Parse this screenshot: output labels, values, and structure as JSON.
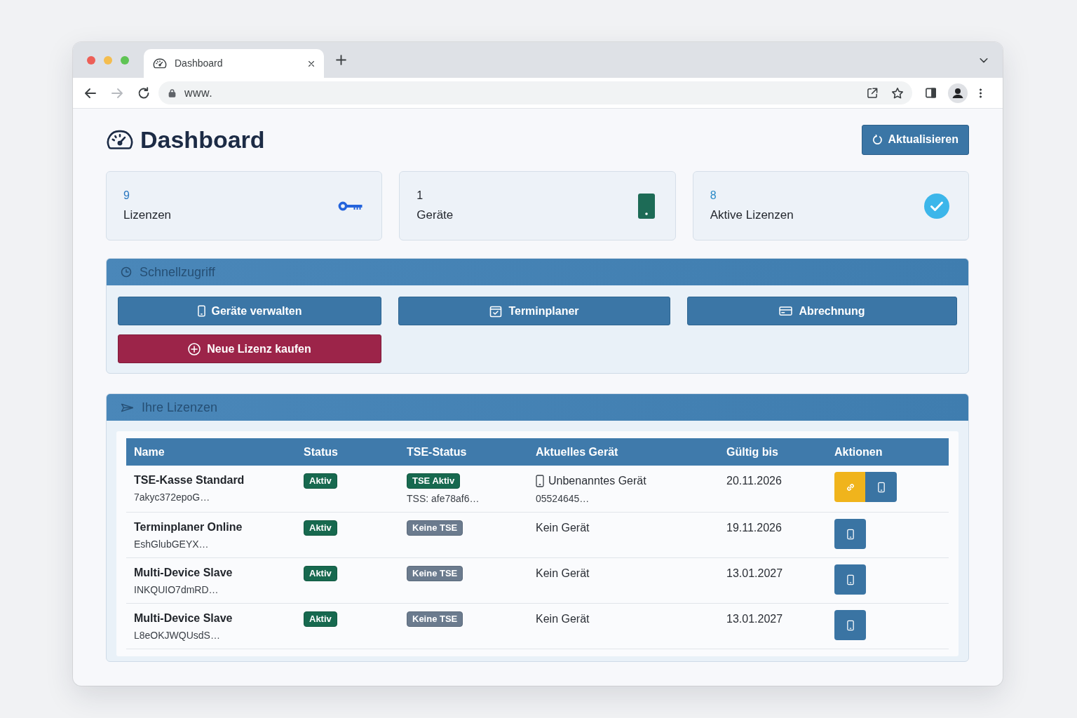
{
  "browser": {
    "tabs": [
      {
        "title": "Dashboard",
        "selected": true
      }
    ],
    "address": "www.",
    "forward_disabled": true
  },
  "header": {
    "title": "Dashboard",
    "refresh_button": "Aktualisieren"
  },
  "stats": [
    {
      "value": "9",
      "label": "Lizenzen",
      "color": "#2464dc"
    },
    {
      "value": "1",
      "label": "Geräte",
      "color": "#1d6b56"
    },
    {
      "value": "8",
      "label": "Aktive Lizenzen",
      "color": "#3cb6ea"
    }
  ],
  "quick_access": {
    "title": "Schnellzugriff",
    "buttons": [
      {
        "label": "Geräte verwalten",
        "kind": "primary"
      },
      {
        "label": "Terminplaner",
        "kind": "primary"
      },
      {
        "label": "Abrechnung",
        "kind": "primary"
      },
      {
        "label": "Neue Lizenz kaufen",
        "kind": "danger"
      }
    ]
  },
  "licenses": {
    "title": "Ihre Lizenzen",
    "table": {
      "columns": [
        "Name",
        "Status",
        "TSE-Status",
        "Aktuelles Gerät",
        "Gültig bis",
        "Aktionen"
      ],
      "rows": [
        {
          "name": "TSE-Kasse Standard",
          "key": "7akyc372epoG…",
          "status": {
            "text": "Aktiv",
            "kind": "success"
          },
          "tse": {
            "text": "TSE Aktiv",
            "kind": "success",
            "detail": "TSS: afe78af6…"
          },
          "device": {
            "kind": "assigned",
            "name": "Unbenanntes Gerät",
            "detail": "05524645…"
          },
          "valid_until": "20.11.2026",
          "actions": [
            {
              "kind": "link"
            },
            {
              "kind": "device"
            }
          ]
        },
        {
          "name": "Terminplaner Online",
          "key": "EshGlubGEYX…",
          "status": {
            "text": "Aktiv",
            "kind": "success"
          },
          "tse": {
            "text": "Keine TSE",
            "kind": "secondary"
          },
          "device": {
            "kind": "none",
            "name": "Kein Gerät"
          },
          "valid_until": "19.11.2026",
          "actions": [
            {
              "kind": "device"
            }
          ]
        },
        {
          "name": "Multi-Device Slave",
          "key": "INKQUIO7dmRD…",
          "status": {
            "text": "Aktiv",
            "kind": "success"
          },
          "tse": {
            "text": "Keine TSE",
            "kind": "secondary"
          },
          "device": {
            "kind": "none",
            "name": "Kein Gerät"
          },
          "valid_until": "13.01.2027",
          "actions": [
            {
              "kind": "device"
            }
          ]
        },
        {
          "name": "Multi-Device Slave",
          "key": "L8eOKJWQUsdS…",
          "status": {
            "text": "Aktiv",
            "kind": "success"
          },
          "tse": {
            "text": "Keine TSE",
            "kind": "secondary"
          },
          "device": {
            "kind": "none",
            "name": "Kein Gerät"
          },
          "valid_until": "13.01.2027",
          "actions": [
            {
              "kind": "device"
            }
          ]
        }
      ]
    }
  }
}
